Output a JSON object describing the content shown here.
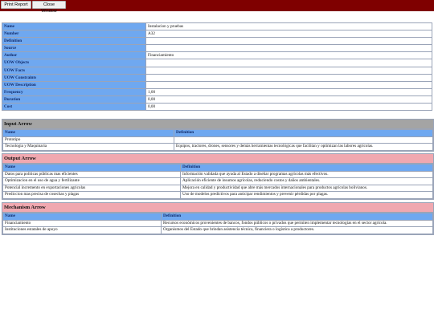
{
  "toolbar": {
    "print_label": "Print Report",
    "close_label": "Close Window"
  },
  "properties": [
    {
      "label": "Name",
      "value": "Instalacion y pruebas"
    },
    {
      "label": "Number",
      "value": "A32"
    },
    {
      "label": "Definition",
      "value": ""
    },
    {
      "label": "Source",
      "value": ""
    },
    {
      "label": "Author",
      "value": "Financiamiento"
    },
    {
      "label": "UOW Objects",
      "value": ""
    },
    {
      "label": "UOW Facts",
      "value": ""
    },
    {
      "label": "UOW Constraints",
      "value": ""
    },
    {
      "label": "UOW Description",
      "value": ""
    },
    {
      "label": "Frequency",
      "value": "1,00"
    },
    {
      "label": "Duration",
      "value": "0,00"
    },
    {
      "label": "Cost",
      "value": "0,00"
    }
  ],
  "input_arrow": {
    "title": "Input Arrow",
    "col_name": "Name",
    "col_def": "Definition",
    "rows": [
      {
        "name": "Prototipo",
        "def": ""
      },
      {
        "name": "Tecnologia y Maquinaria",
        "def": "Equipos, tractores, drones, sensores y demás herramientas tecnológicas que facilitan y optimizan las labores agrícolas."
      }
    ]
  },
  "output_arrow": {
    "title": "Output Arrow",
    "col_name": "Name",
    "col_def": "Definition",
    "rows": [
      {
        "name": "Datos para politicas públicas mas eficientes",
        "def": "Información validada que ayuda al Estado a diseñar programas agrícolas más efectivos."
      },
      {
        "name": "Optimizacion en el uso de agua y fertilizante",
        "def": "Aplicación eficiente de insumos agrícolas, reduciendo costos y daños ambientales."
      },
      {
        "name": "Potencial incremento en exportaciones agricolas",
        "def": "Mejora en calidad y productividad que abre más mercados internacionales para productos agrícolas bolivianos."
      },
      {
        "name": "Prediccion mas precisa de cosechas y plagas",
        "def": "Uso de modelos predictivos para anticipar rendimientos y prevenir pérdidas por plagas."
      }
    ]
  },
  "mechanism_arrow": {
    "title": "Mechanism Arrow",
    "col_name": "Name",
    "col_def": "Definition",
    "rows": [
      {
        "name": "Financiamiento",
        "def": "Recursos económicos provenientes de bancos, fondos públicos o privados que permiten implementar tecnologías en el sector agrícola."
      },
      {
        "name": "Instituciones estatales de apoyo",
        "def": "Organismos del Estado que brindan asistencia técnica, financiera o logística a productores."
      }
    ]
  }
}
